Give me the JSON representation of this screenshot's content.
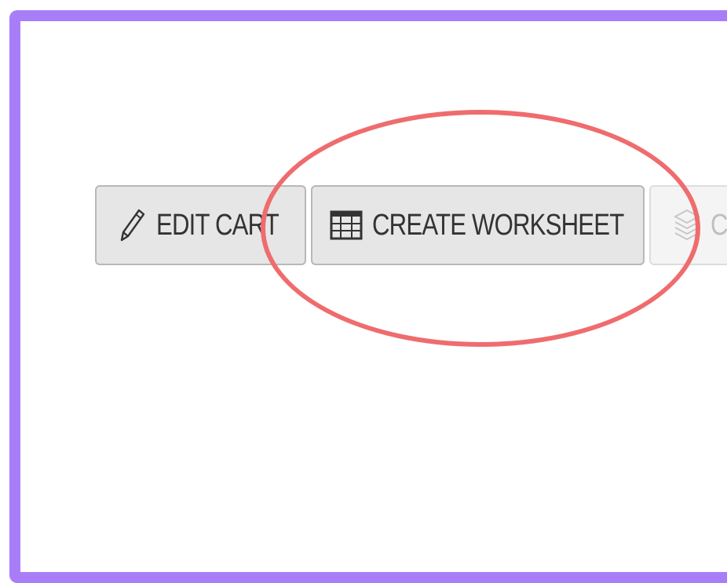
{
  "colors": {
    "frame": "#a77ef8",
    "highlight_ellipse": "#ef6c6e",
    "button_bg": "#e6e6e6",
    "button_text": "#333333",
    "disabled_text": "#bfbfbf"
  },
  "toolbar": {
    "edit_cart": {
      "label": "EDIT CART",
      "icon": "pencil-icon"
    },
    "create_worksheet": {
      "label": "CREATE WORKSHEET",
      "icon": "table-grid-icon"
    },
    "partial_button": {
      "label": "C",
      "icon": "layers-icon"
    }
  }
}
